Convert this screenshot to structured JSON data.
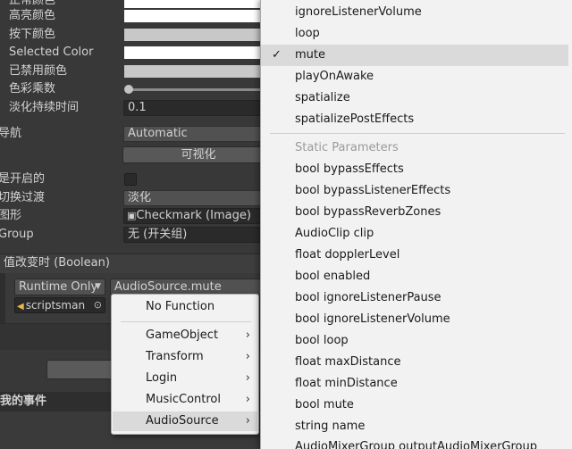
{
  "inspector": {
    "labels": {
      "normal_color": "正常颜色",
      "highlighted_color": "高亮颜色",
      "pressed_color": "按下颜色",
      "selected_color": "Selected Color",
      "disabled_color": "已禁用颜色",
      "color_multiplier": "色彩乘数",
      "fade_duration": "淡化持续时间",
      "navigation": "导航",
      "is_on": "是开启的",
      "toggle_transition": "切换过渡",
      "graphic": "图形",
      "group": "Group"
    },
    "fade_duration_value": "0.1",
    "navigation_value": "Automatic",
    "visualize_button": "可视化",
    "toggle_transition_value": "淡化",
    "graphic_value": "Checkmark (Image)",
    "group_value": "无 (开关组)",
    "event_header": "值改变时 (Boolean)",
    "runtime_dropdown": "Runtime Only",
    "function_dropdown": "AudioSource.mute",
    "object_field": "scriptsman",
    "section_header": "我的事件"
  },
  "menu_left": {
    "items": [
      {
        "label": "No Function",
        "submenu": false
      },
      {
        "label": "GameObject",
        "submenu": true
      },
      {
        "label": "Transform",
        "submenu": true
      },
      {
        "label": "Login",
        "submenu": true
      },
      {
        "label": "MusicControl",
        "submenu": true
      },
      {
        "label": "AudioSource",
        "submenu": true
      }
    ],
    "chevron": "›"
  },
  "menu_right": {
    "check_glyph": "✓",
    "dynamic_items": [
      "ignoreListenerVolume",
      "loop",
      "mute",
      "playOnAwake",
      "spatialize",
      "spatializePostEffects"
    ],
    "checked_item": "mute",
    "static_header": "Static Parameters",
    "static_items": [
      "bool bypassEffects",
      "bool bypassListenerEffects",
      "bool bypassReverbZones",
      "AudioClip clip",
      "float dopplerLevel",
      "bool enabled",
      "bool ignoreListenerPause",
      "bool ignoreListenerVolume",
      "bool loop",
      "float maxDistance",
      "float minDistance",
      "bool mute",
      "string name",
      "AudioMixerGroup outputAudioMixerGroup"
    ]
  },
  "colors": {
    "editor_bg": "#383838",
    "menu_bg": "#f2f2f2",
    "menu_highlight": "#dadada",
    "disabled_text": "#9a9a9a"
  }
}
